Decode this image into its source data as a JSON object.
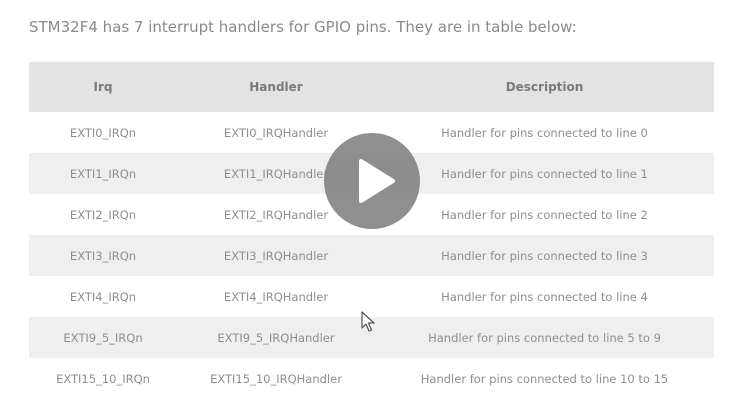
{
  "intro_text": "STM32F4 has 7 interrupt handlers for GPIO pins. They are in table below:",
  "table": {
    "headers": {
      "irq": "Irq",
      "handler": "Handler",
      "description": "Description"
    },
    "rows": [
      {
        "irq": "EXTI0_IRQn",
        "handler": "EXTI0_IRQHandler",
        "description": "Handler for pins connected to line 0"
      },
      {
        "irq": "EXTI1_IRQn",
        "handler": "EXTI1_IRQHandler",
        "description": "Handler for pins connected to line 1"
      },
      {
        "irq": "EXTI2_IRQn",
        "handler": "EXTI2_IRQHandler",
        "description": "Handler for pins connected to line 2"
      },
      {
        "irq": "EXTI3_IRQn",
        "handler": "EXTI3_IRQHandler",
        "description": "Handler for pins connected to line 3"
      },
      {
        "irq": "EXTI4_IRQn",
        "handler": "EXTI4_IRQHandler",
        "description": "Handler for pins connected to line 4"
      },
      {
        "irq": "EXTI9_5_IRQn",
        "handler": "EXTI9_5_IRQHandler",
        "description": "Handler for pins connected to line 5 to 9"
      },
      {
        "irq": "EXTI15_10_IRQn",
        "handler": "EXTI15_10_IRQHandler",
        "description": "Handler for pins connected to line 10 to 15"
      }
    ]
  },
  "icons": {
    "play": "play-icon",
    "cursor": "mouse-cursor-icon"
  },
  "colors": {
    "header_bg": "#e3e3e3",
    "stripe_bg": "#efefef",
    "text": "#8e8e8e",
    "play_button": "#808080"
  }
}
